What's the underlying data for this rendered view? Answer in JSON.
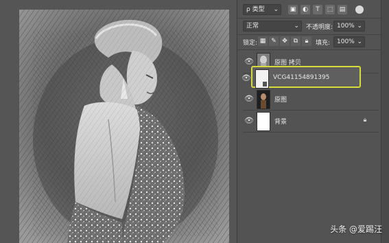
{
  "toolbar": {
    "filter_prefix": "ρ",
    "filter_label": "类型",
    "blend_mode": "正常",
    "opacity_label": "不透明度:",
    "opacity_value": "100%",
    "lock_label": "锁定:",
    "fill_label": "填充:",
    "fill_value": "100%"
  },
  "layers": [
    {
      "name": "原图 拷贝",
      "selected": false,
      "locked": false
    },
    {
      "name": "VCG41154891395",
      "selected": true,
      "locked": false
    },
    {
      "name": "原图",
      "selected": false,
      "locked": false
    },
    {
      "name": "背景",
      "selected": false,
      "locked": true
    }
  ],
  "watermark": "头条 @爱踢汪",
  "colors": {
    "selection_outline": "#d7dc3a",
    "panel_bg": "#535353",
    "canvas_bg": "#555555"
  }
}
